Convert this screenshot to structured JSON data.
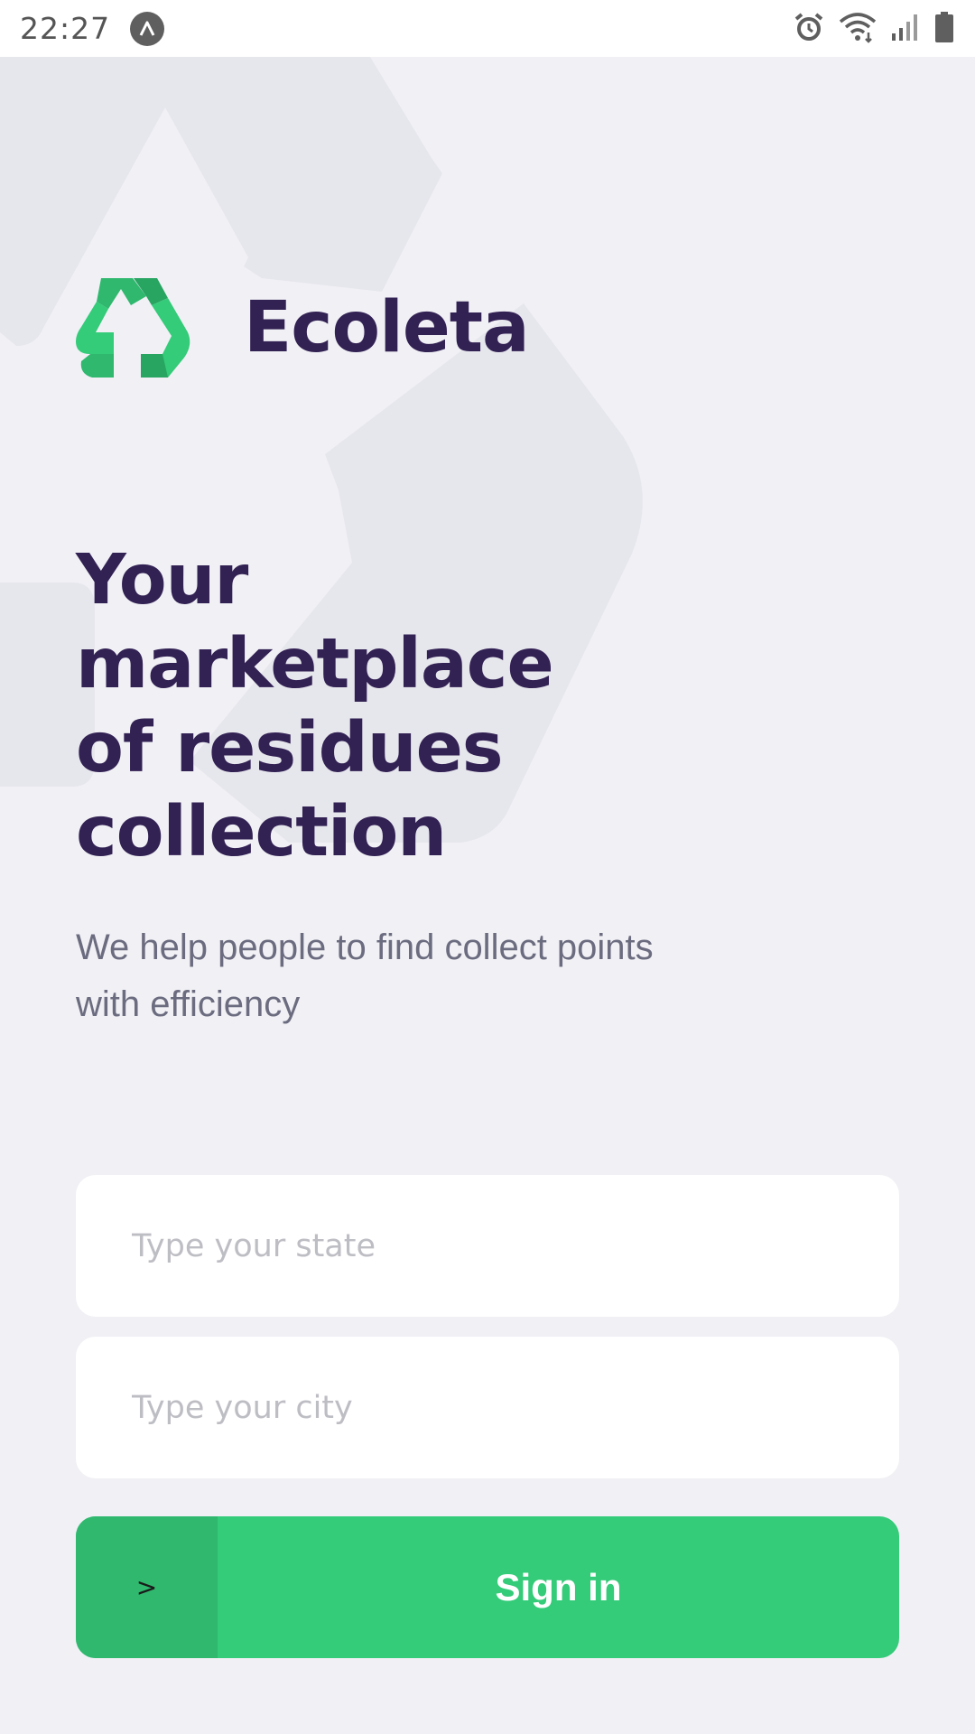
{
  "status_bar": {
    "time": "22:27",
    "icons": [
      "app-notification-icon",
      "alarm-icon",
      "wifi-icon",
      "signal-icon",
      "battery-icon"
    ]
  },
  "brand": {
    "name": "Ecoleta",
    "logo_icon": "recycle-icon",
    "color_primary": "#322153",
    "color_accent": "#34CB79"
  },
  "hero": {
    "headline_lines": [
      "Your",
      "marketplace",
      "of residues",
      "collection"
    ],
    "subtitle_lines": [
      "We help people to find collect points",
      "with efficiency"
    ]
  },
  "form": {
    "state_placeholder": "Type your state",
    "city_placeholder": "Type your city",
    "signin_icon": ">",
    "signin_label": "Sign in"
  }
}
